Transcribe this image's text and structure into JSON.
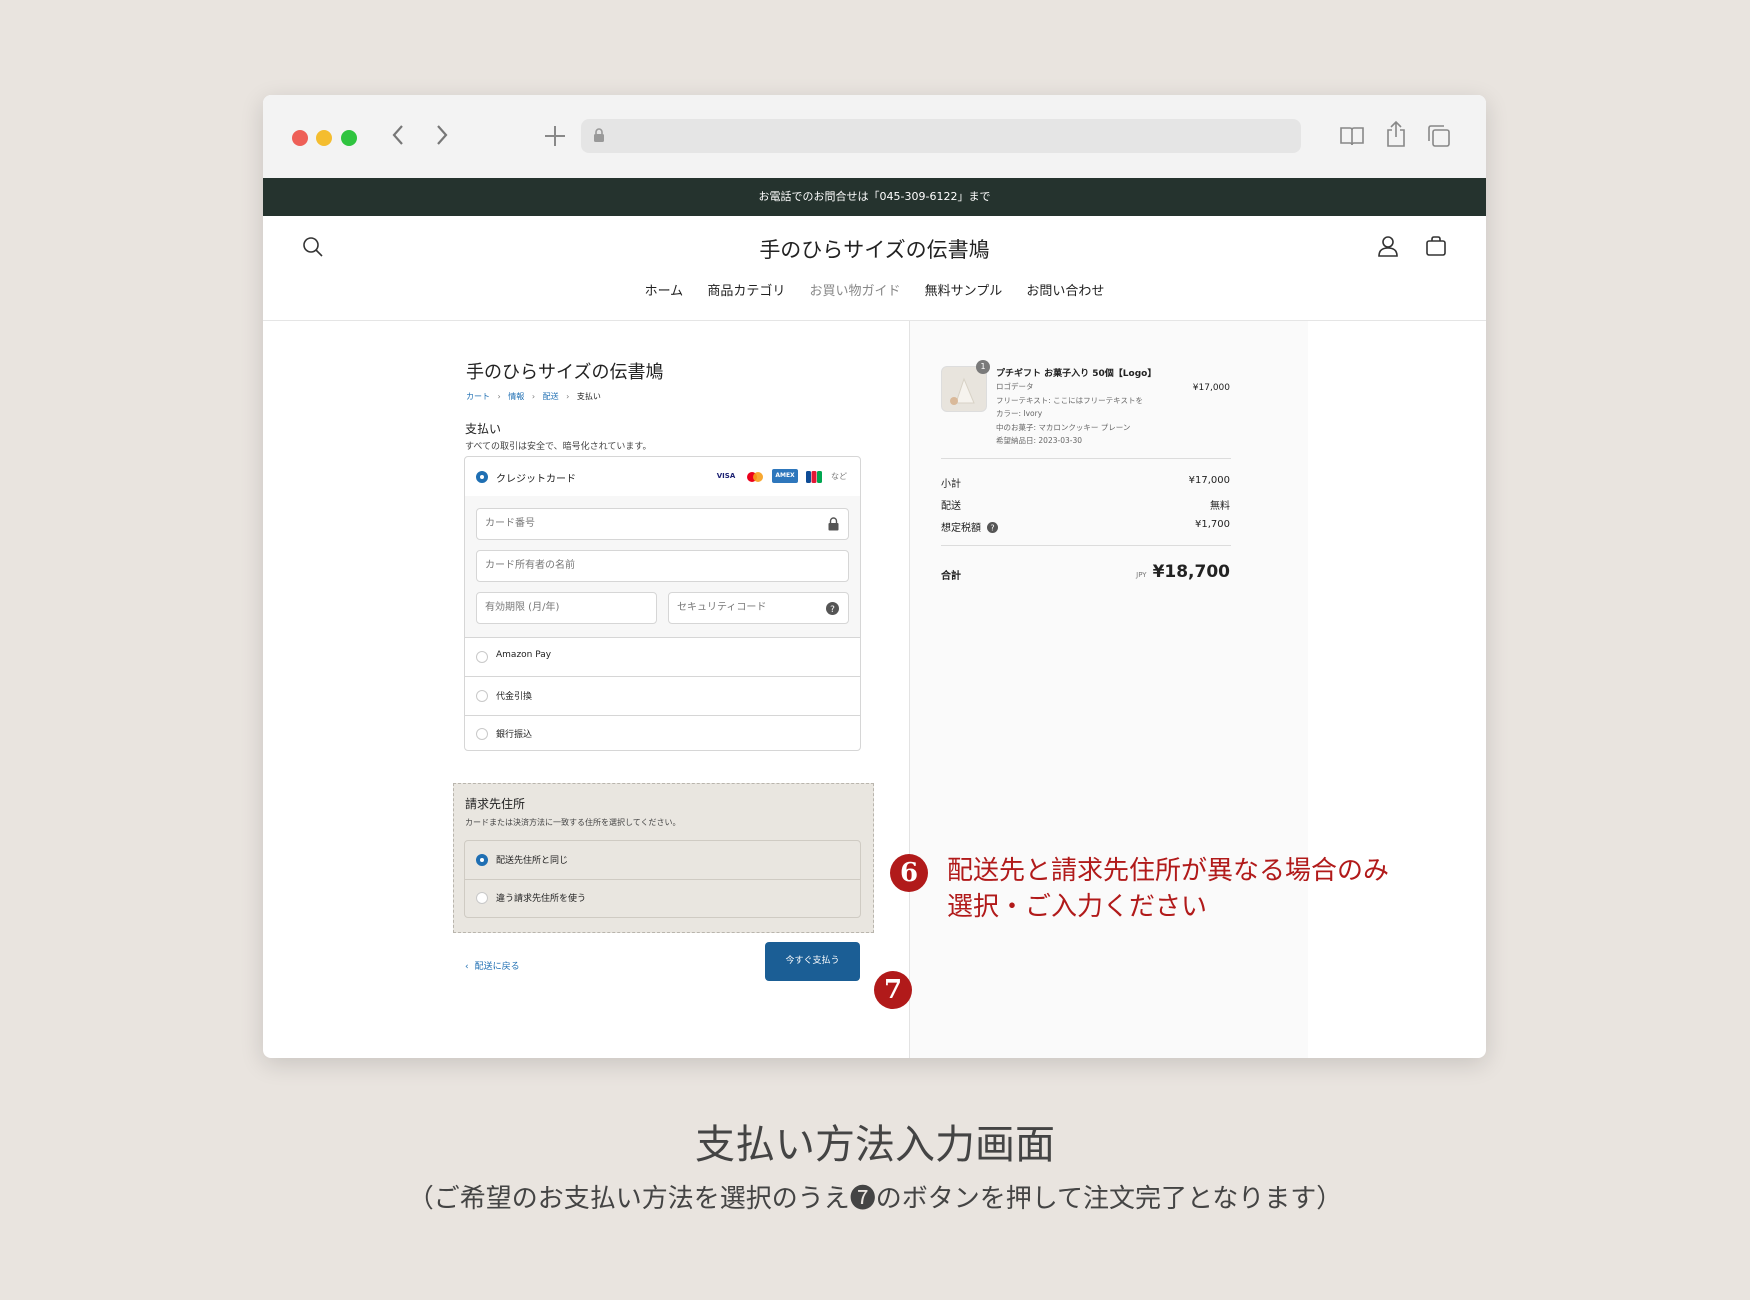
{
  "browser": {
    "url": "",
    "icons": [
      "close-dot",
      "minimize-dot",
      "zoom-dot",
      "back-icon",
      "forward-icon",
      "new-tab-icon",
      "lock-icon",
      "reader-icon",
      "share-icon",
      "tabs-icon"
    ]
  },
  "store": {
    "announcement": "お電話でのお問合せは「045-309-6122」まで",
    "title": "手のひらサイズの伝書鳩",
    "nav": [
      "ホーム",
      "商品カテゴリ",
      "お買い物ガイド",
      "無料サンプル",
      "お問い合わせ"
    ]
  },
  "checkout": {
    "title": "手のひらサイズの伝書鳩",
    "breadcrumb": [
      "カート",
      "情報",
      "配送",
      "支払い"
    ],
    "payment_heading": "支払い",
    "payment_subtext": "すべての取引は安全で、暗号化されています。",
    "methods": {
      "credit_card": "クレジットカード",
      "card_brands": [
        "VISA",
        "MC",
        "AMEX",
        "JCB"
      ],
      "card_brands_more": "など",
      "amazon_pay": "Amazon Pay",
      "cod": "代金引換",
      "bank": "銀行振込"
    },
    "fields": {
      "card_number": "カード番号",
      "card_name": "カード所有者の名前",
      "expiry": "有効期限 (月/年)",
      "security_code": "セキュリティコード"
    },
    "billing": {
      "heading": "請求先住所",
      "subtext": "カードまたは決済方法に一致する住所を選択してください。",
      "same": "配送先住所と同じ",
      "different": "違う請求先住所を使う"
    },
    "back_link": "配送に戻る",
    "pay_button": "今すぐ支払う"
  },
  "summary": {
    "item": {
      "qty_badge": "1",
      "name": "プチギフト お菓子入り 50個【Logo】",
      "details": [
        "ロゴデータ",
        "フリーテキスト: ここにはフリーテキストを",
        "カラー: Ivory",
        "中のお菓子: マカロンクッキー プレーン",
        "希望納品日: 2023-03-30"
      ],
      "price": "¥17,000"
    },
    "subtotal_label": "小計",
    "subtotal": "¥17,000",
    "shipping_label": "配送",
    "shipping": "無料",
    "tax_label": "想定税額",
    "tax": "¥1,700",
    "total_label": "合計",
    "currency": "JPY",
    "total": "¥18,700"
  },
  "annotations": {
    "step6_number": "6",
    "step6_text_line1": "配送先と請求先住所が異なる場合のみ",
    "step6_text_line2": "選択・ご入力ください",
    "step7_number": "7"
  },
  "caption": {
    "title": "支払い方法入力画面",
    "subtitle": "（ご希望のお支払い方法を選択のうえ❼のボタンを押して注文完了となります）"
  },
  "colors": {
    "announce_bg": "#25332e",
    "accent_blue": "#1f6fb3",
    "pay_button": "#1b5e95",
    "annotation_red": "#b11a1a",
    "page_bg": "#e9e4df"
  }
}
